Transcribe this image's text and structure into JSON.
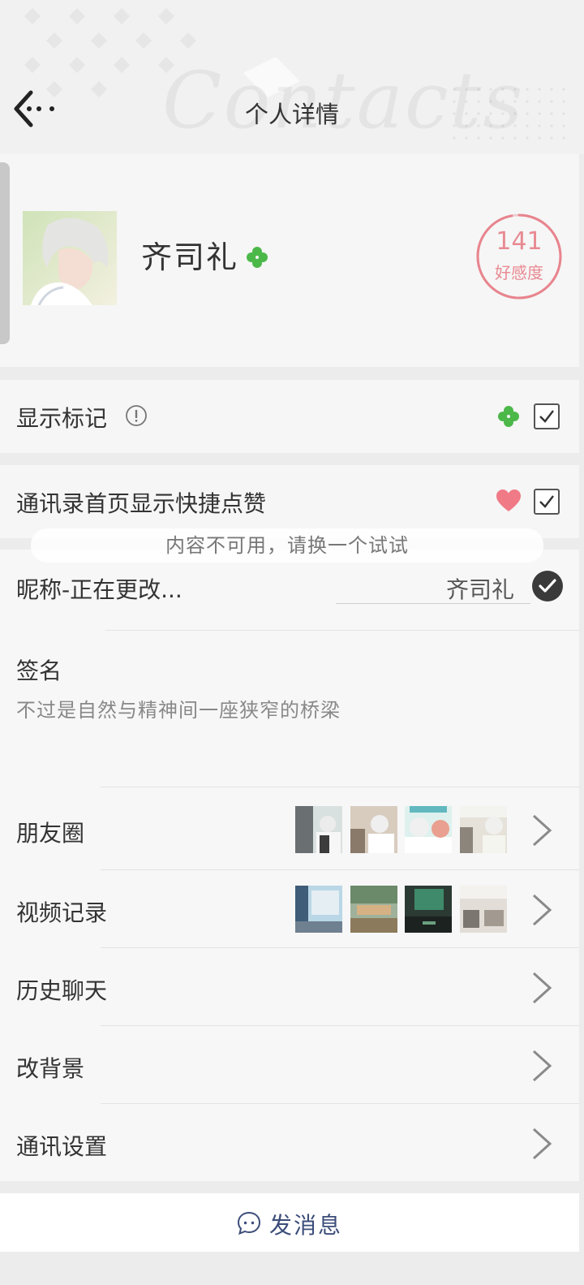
{
  "header": {
    "title": "个人详情",
    "watermark": "Contacts"
  },
  "profile": {
    "name": "齐司礼",
    "affinity_value": "141",
    "affinity_label": "好感度",
    "affinity_progress": 0.97
  },
  "settings": {
    "show_mark_label": "显示标记",
    "show_mark_checked": true,
    "quick_like_label": "通讯录首页显示快捷点赞",
    "quick_like_checked": true
  },
  "toast": {
    "text": "内容不可用，请换一个试试"
  },
  "nickname": {
    "label": "昵称-正在更改...",
    "value": "齐司礼"
  },
  "signature": {
    "label": "签名",
    "text": "不过是自然与精神间一座狭窄的桥梁"
  },
  "menu": [
    {
      "label": "朋友圈"
    },
    {
      "label": "视频记录"
    },
    {
      "label": "历史聊天"
    },
    {
      "label": "改背景"
    },
    {
      "label": "通讯设置"
    }
  ],
  "send": {
    "label": "发消息"
  },
  "colors": {
    "clover": "#4cb84a",
    "heart": "#f07a86",
    "affinity": "#e88a92",
    "send_text": "#3c4d7a"
  },
  "icons": [
    "back-arrow-icon",
    "info-icon",
    "clover-icon",
    "heart-icon",
    "checkmark-icon",
    "chevron-right-icon",
    "chat-bubble-icon"
  ]
}
